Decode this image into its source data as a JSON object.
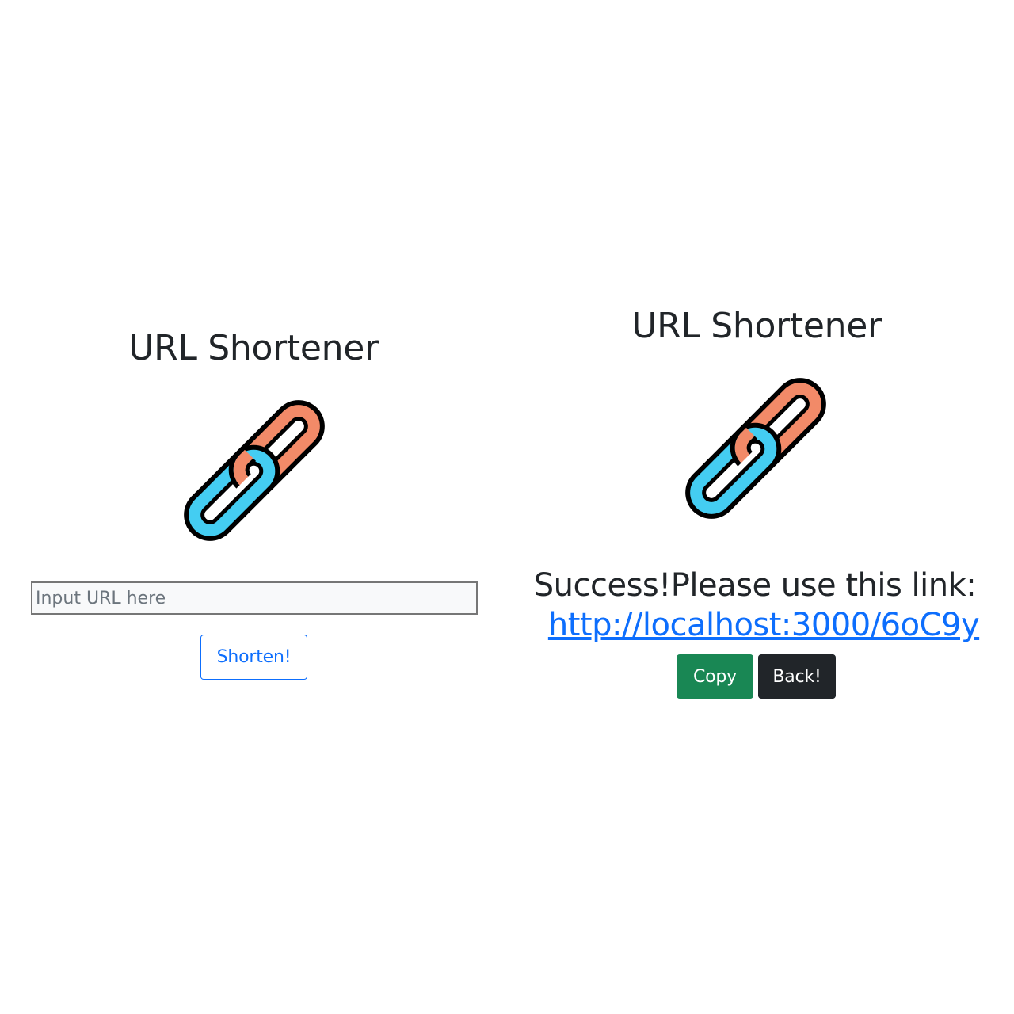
{
  "left_view": {
    "title": "URL Shortener",
    "logo_icon": "chain-link-icon",
    "url_input": {
      "value": "",
      "placeholder": "Input URL here"
    },
    "shorten_button_label": "Shorten!"
  },
  "right_view": {
    "title": "URL Shortener",
    "logo_icon": "chain-link-icon",
    "success_message": "Success!Please use this link:",
    "short_link": "http://localhost:3000/6oC9y",
    "copy_button_label": "Copy",
    "back_button_label": "Back!"
  },
  "colors": {
    "chain_orange": "#f28a68",
    "chain_blue": "#44cdf2",
    "outline": "#000000",
    "primary": "#0d6efd",
    "success": "#198754",
    "dark": "#212529"
  }
}
